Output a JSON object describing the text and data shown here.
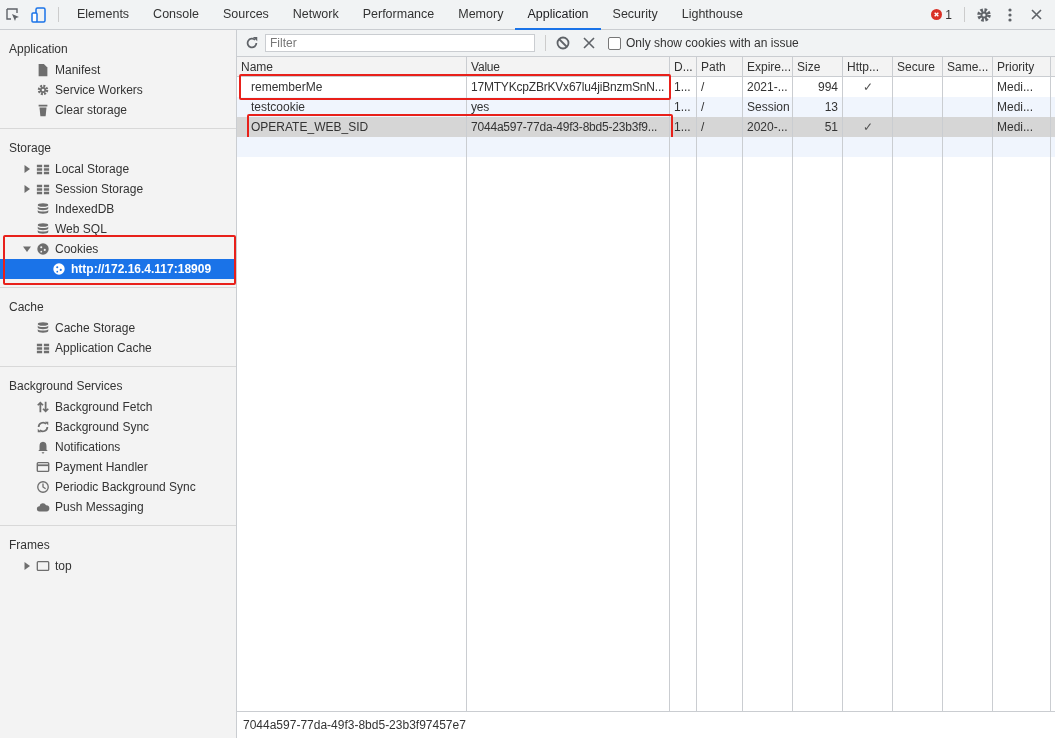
{
  "tabs": [
    {
      "label": "Elements",
      "selected": false
    },
    {
      "label": "Console",
      "selected": false
    },
    {
      "label": "Sources",
      "selected": false
    },
    {
      "label": "Network",
      "selected": false
    },
    {
      "label": "Performance",
      "selected": false
    },
    {
      "label": "Memory",
      "selected": false
    },
    {
      "label": "Application",
      "selected": true
    },
    {
      "label": "Security",
      "selected": false
    },
    {
      "label": "Lighthouse",
      "selected": false
    }
  ],
  "error_count": "1",
  "sidebar": {
    "sections": [
      {
        "title": "Application",
        "items": [
          {
            "label": "Manifest",
            "kind": "file",
            "selected": false
          },
          {
            "label": "Service Workers",
            "kind": "gear",
            "selected": false
          },
          {
            "label": "Clear storage",
            "kind": "trash",
            "selected": false
          }
        ]
      },
      {
        "title": "Storage",
        "items": [
          {
            "label": "Local Storage",
            "kind": "grid",
            "expanded": false,
            "selected": false
          },
          {
            "label": "Session Storage",
            "kind": "grid",
            "expanded": false,
            "selected": false
          },
          {
            "label": "IndexedDB",
            "kind": "database",
            "selected": false
          },
          {
            "label": "Web SQL",
            "kind": "database",
            "selected": false
          },
          {
            "label": "Cookies",
            "kind": "cookie",
            "expanded": true,
            "selected": false,
            "annotated": true,
            "children": [
              {
                "label": "http://172.16.4.117:18909",
                "kind": "cookie",
                "selected": true
              }
            ]
          }
        ]
      },
      {
        "title": "Cache",
        "items": [
          {
            "label": "Cache Storage",
            "kind": "database",
            "selected": false
          },
          {
            "label": "Application Cache",
            "kind": "grid",
            "selected": false
          }
        ]
      },
      {
        "title": "Background Services",
        "items": [
          {
            "label": "Background Fetch",
            "kind": "arrows",
            "selected": false
          },
          {
            "label": "Background Sync",
            "kind": "sync",
            "selected": false
          },
          {
            "label": "Notifications",
            "kind": "bell",
            "selected": false
          },
          {
            "label": "Payment Handler",
            "kind": "card",
            "selected": false
          },
          {
            "label": "Periodic Background Sync",
            "kind": "clock",
            "selected": false
          },
          {
            "label": "Push Messaging",
            "kind": "cloud",
            "selected": false
          }
        ]
      },
      {
        "title": "Frames",
        "items": [
          {
            "label": "top",
            "kind": "frame",
            "expanded": false,
            "selected": false
          }
        ]
      }
    ]
  },
  "toolbar": {
    "filter": {
      "placeholder": "Filter"
    },
    "issue_checkbox": {
      "label": "Only show cookies with an issue",
      "checked": false
    }
  },
  "table": {
    "columns": [
      "Name",
      "Value",
      "D...",
      "Path",
      "Expire...",
      "Size",
      "Http...",
      "Secure",
      "Same...",
      "Priority"
    ],
    "rows": [
      {
        "cells": [
          "rememberMe",
          "17MTYKcpZBrKVx67lu4jiBnzmSnN...",
          "1...",
          "/",
          "2021-...",
          "994",
          "✓",
          "",
          "",
          "Medi..."
        ],
        "selected": false,
        "annotated": true
      },
      {
        "cells": [
          "testcookie",
          "yes",
          "1...",
          "/",
          "Session",
          "13",
          "",
          "",
          "",
          "Medi..."
        ],
        "selected": false,
        "annotated": false
      },
      {
        "cells": [
          "OPERATE_WEB_SID",
          "7044a597-77da-49f3-8bd5-23b3f9...",
          "1...",
          "/",
          "2020-...",
          "51",
          "✓",
          "",
          "",
          "Medi..."
        ],
        "selected": true,
        "annotated": true
      }
    ]
  },
  "status_bar": {
    "value": "7044a597-77da-49f3-8bd5-23b3f97457e7"
  }
}
